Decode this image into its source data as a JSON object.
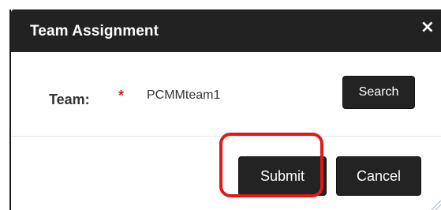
{
  "dialog": {
    "title": "Team Assignment",
    "close_glyph": "×",
    "close_icon": "close-icon"
  },
  "form": {
    "team_label": "Team:",
    "required_marker": "*",
    "team_value": "PCMMteam1",
    "search_label": "Search"
  },
  "footer": {
    "submit_label": "Submit",
    "cancel_label": "Cancel"
  },
  "annotation": {
    "highlight_color": "#e11818",
    "highlight_target": "submit-button"
  },
  "colors": {
    "titlebar": "#222222",
    "button": "#232323",
    "required": "#cc2222"
  }
}
